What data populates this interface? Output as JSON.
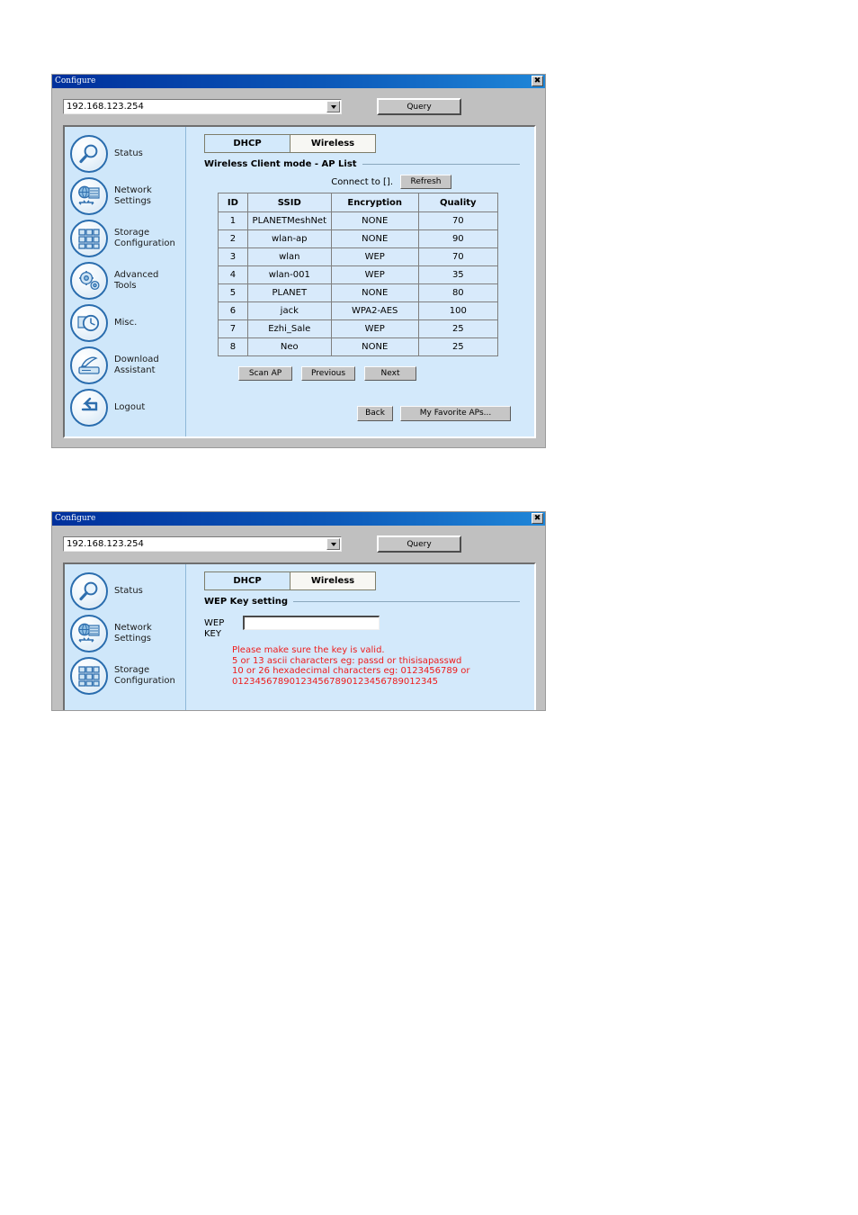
{
  "windows": [
    {
      "title": "Configure",
      "close_icon": "close-icon",
      "close_glyph": "✖",
      "address": {
        "value": "192.168.123.254",
        "placeholder": "192.168.123.254",
        "dropdown_icon": "chevron-down-icon"
      },
      "query_label": "Query",
      "sidebar": {
        "items": [
          {
            "label": "Status",
            "icon": "magnifier-icon"
          },
          {
            "label": "Network\nSettings",
            "icon": "network-globe-icon"
          },
          {
            "label": "Storage\nConfiguration",
            "icon": "storage-grid-icon"
          },
          {
            "label": "Advanced\nTools",
            "icon": "gears-icon"
          },
          {
            "label": "Misc.",
            "icon": "clock-icon"
          },
          {
            "label": "Download\nAssistant",
            "icon": "download-scanner-icon"
          },
          {
            "label": "Logout",
            "icon": "logout-arrow-icon"
          }
        ]
      },
      "tabs": [
        {
          "label": "DHCP",
          "active": false
        },
        {
          "label": "Wireless",
          "active": true
        }
      ],
      "section_title": "Wireless Client mode - AP List",
      "connect_to_label": "Connect to [].",
      "refresh_label": "Refresh",
      "table": {
        "headers": [
          "ID",
          "SSID",
          "Encryption",
          "Quality"
        ],
        "rows": [
          [
            "1",
            "PLANETMeshNet",
            "NONE",
            "70"
          ],
          [
            "2",
            "wlan-ap",
            "NONE",
            "90"
          ],
          [
            "3",
            "wlan",
            "WEP",
            "70"
          ],
          [
            "4",
            "wlan-001",
            "WEP",
            "35"
          ],
          [
            "5",
            "PLANET",
            "NONE",
            "80"
          ],
          [
            "6",
            "jack",
            "WPA2-AES",
            "100"
          ],
          [
            "7",
            "Ezhi_Sale",
            "WEP",
            "25"
          ],
          [
            "8",
            "Neo",
            "NONE",
            "25"
          ]
        ]
      },
      "buttons_primary": [
        "Scan AP",
        "Previous",
        "Next"
      ],
      "buttons_footer": [
        "Back",
        "My Favorite APs..."
      ]
    },
    {
      "title": "Configure",
      "close_glyph": "✖",
      "address": {
        "value": "192.168.123.254",
        "placeholder": "192.168.123.254",
        "dropdown_icon": "chevron-down-icon"
      },
      "query_label": "Query",
      "sidebar": {
        "items": [
          {
            "label": "Status",
            "icon": "magnifier-icon"
          },
          {
            "label": "Network\nSettings",
            "icon": "network-globe-icon"
          },
          {
            "label": "Storage\nConfiguration",
            "icon": "storage-grid-icon"
          }
        ]
      },
      "tabs": [
        {
          "label": "DHCP",
          "active": false
        },
        {
          "label": "Wireless",
          "active": true
        }
      ],
      "section_title": "WEP Key setting",
      "wep": {
        "label_line1": "WEP",
        "label_line2": "KEY",
        "value": "",
        "placeholder": "",
        "note_lines": [
          "Please make sure the key is valid.",
          "5 or 13 ascii characters eg: passd or thisisapasswd",
          "10 or 26 hexadecimal characters eg: 0123456789 or",
          "012345678901234567890123456789012345"
        ]
      }
    }
  ],
  "colors": {
    "title_gradient_start": "#00309c",
    "title_gradient_end": "#1f86d8",
    "window_face": "#c0c0c0",
    "content_blue": "#d3e9fb",
    "sidebar_blue": "#cfe7fa",
    "icon_border": "#2a6dae",
    "warning_red": "#ee1c1c",
    "table_border": "#7f7f7f"
  }
}
